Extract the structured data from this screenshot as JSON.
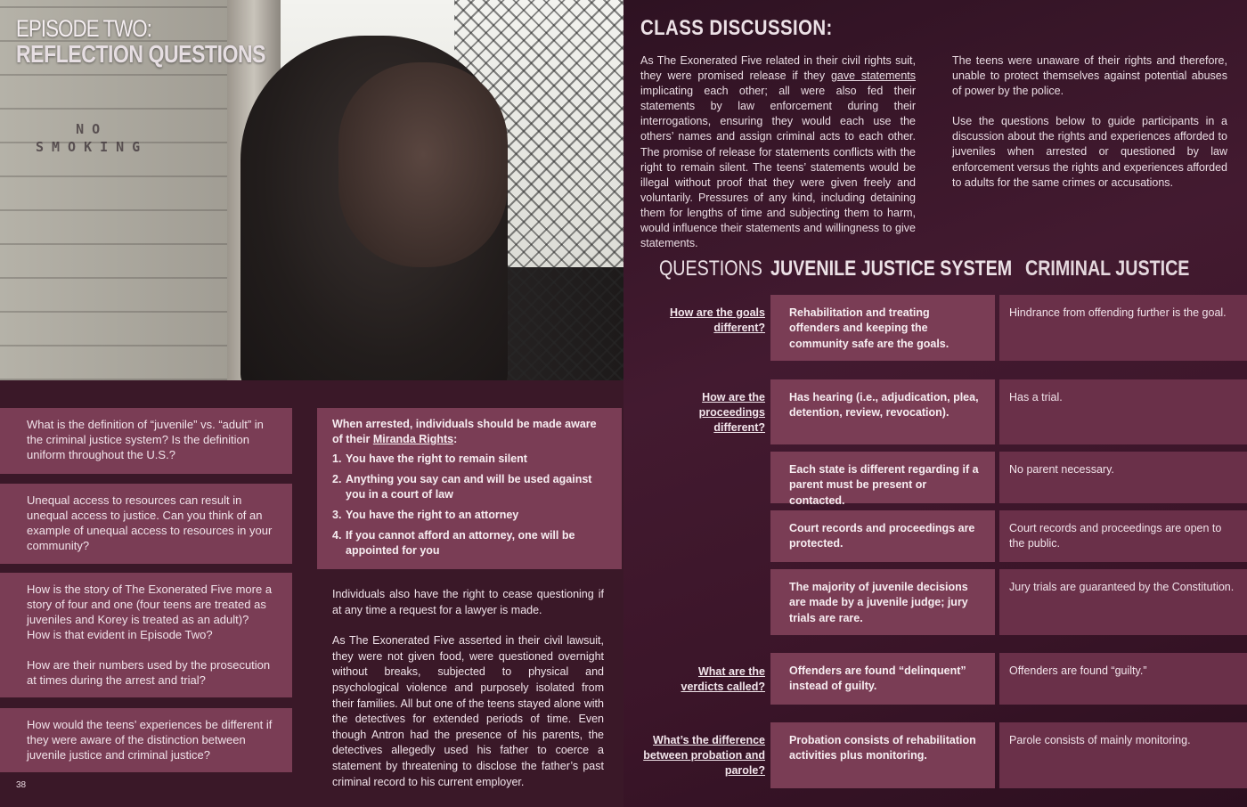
{
  "left_page": {
    "title_line1": "EPISODE TWO:",
    "title_line2": "REFLECTION QUESTIONS",
    "photo_sign_line1": "NO",
    "photo_sign_line2": "SMOKING",
    "question_boxes": [
      {
        "paragraphs": [
          "What is the definition of “juvenile” vs. “adult” in the criminal justice system? Is the definition uniform throughout the U.S.?"
        ]
      },
      {
        "paragraphs": [
          "Unequal access to resources can result in unequal access to justice. Can you think of an example of unequal access to resources in your community?"
        ]
      },
      {
        "paragraphs": [
          "How is the story of The Exonerated Five more a story of four and one (four teens are treated as juveniles and Korey is treated as an adult)? How is that evident in Episode Two?",
          "How are their numbers used by the prosecution at times during the arrest and trial?"
        ]
      },
      {
        "paragraphs": [
          "How would the teens’ experiences be different if they were aware of the distinction between juvenile justice and criminal justice?"
        ]
      }
    ],
    "miranda": {
      "intro": "When arrested, individuals should be made aware of their",
      "link": "Miranda Rights",
      "colon": ":",
      "rights": [
        {
          "num": "1.",
          "text": "You have the right to remain silent"
        },
        {
          "num": "2.",
          "text": "Anything you say can and will be used against you in a court of law"
        },
        {
          "num": "3.",
          "text": "You have the right to an attorney"
        },
        {
          "num": "4.",
          "text": "If you cannot afford an attorney, one will be appointed for you"
        }
      ]
    },
    "body_paragraphs": [
      "Individuals also have the right to cease questioning if at any time a request for a lawyer is made.",
      "As The Exonerated Five asserted in their civil lawsuit, they were not given food, were questioned overnight without breaks, subjected to physical and psychological violence and purposely isolated from their families. All but one of the teens stayed alone with the detectives for extended periods of time. Even though Antron had the presence of his parents, the detectives allegedly used his father to coerce a statement by threatening to disclose the father’s past criminal record to his current employer."
    ],
    "page_number": "38"
  },
  "right_page": {
    "title": "CLASS DISCUSSION:",
    "col1": {
      "before": "As The Exonerated Five related in their civil rights suit, they were promised release if they",
      "link": "gave statements",
      "after": "implicating each other; all were also fed their statements by law enforcement during their interrogations, ensuring they would each use the others’ names and assign criminal acts to each other. The promise of release for statements conflicts with the right to remain silent. The teens’ statements would be illegal without proof that they were given freely and voluntarily. Pressures of any kind, including detaining them for lengths of time and subjecting them to harm, would influence their statements and willingness to give statements."
    },
    "col2": [
      "The teens were unaware of their rights and therefore, unable to protect themselves against potential abuses of power by the police.",
      "Use the questions below to guide participants in a discussion about the rights and experiences afforded to juveniles when arrested or questioned by law enforcement versus the rights and experiences afforded to adults for the same crimes or accusations."
    ],
    "table": {
      "headers": [
        "QUESTIONS",
        "JUVENILE JUSTICE SYSTEM",
        "CRIMINAL JUSTICE"
      ],
      "questions": [
        "How are the goals different?",
        "How are the proceedings different?",
        "What are the verdicts called?",
        "What’s the difference between probation and parole?"
      ],
      "rows": [
        {
          "juvenile": "Rehabilitation and treating offenders and keeping the community safe are the goals.",
          "criminal": "Hindrance from offending further is the goal."
        },
        {
          "juvenile": "Has hearing (i.e., adjudication, plea, detention, review, revocation).",
          "criminal": "Has a trial."
        },
        {
          "juvenile": "Each state is different regarding if a parent must be present or contacted.",
          "criminal": "No parent necessary."
        },
        {
          "juvenile": "Court records and proceedings are protected.",
          "criminal": "Court records and proceedings are open to the public."
        },
        {
          "juvenile": "The majority of juvenile decisions are made by a juvenile judge; jury trials are rare.",
          "criminal": "Jury trials are guaranteed by the Constitution."
        },
        {
          "juvenile": "Offenders are found “delinquent” instead of guilty.",
          "criminal": "Offenders are found “guilty.”"
        },
        {
          "juvenile": "Probation consists of rehabilitation activities plus monitoring.",
          "criminal": "Parole consists of mainly monitoring."
        }
      ]
    }
  },
  "colors": {
    "page_bg": "#3a1828",
    "box": "#7a3d55",
    "box_alt": "#6a3049",
    "text": "#f1e3ea"
  }
}
